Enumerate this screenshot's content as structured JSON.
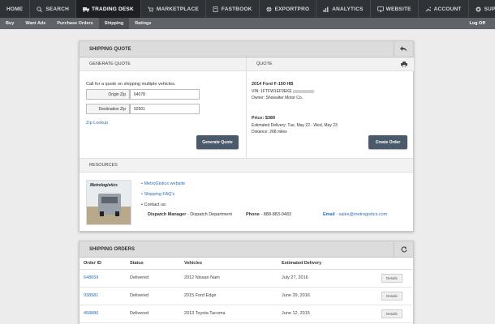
{
  "topnav": [
    {
      "label": "HOME",
      "icon": "none",
      "active": false
    },
    {
      "label": "SEARCH",
      "icon": "search-icon",
      "active": false
    },
    {
      "label": "TRADING DESK",
      "icon": "truck-icon",
      "active": true
    },
    {
      "label": "MARKETPLACE",
      "icon": "cart-icon",
      "active": false
    },
    {
      "label": "FASTBOOK",
      "icon": "book-icon",
      "active": false
    },
    {
      "label": "EXPORTPRO",
      "icon": "globe-icon",
      "active": false
    },
    {
      "label": "ANALYTICS",
      "icon": "chart-icon",
      "active": false
    },
    {
      "label": "WEBSITE",
      "icon": "monitor-icon",
      "active": false
    },
    {
      "label": "ACCOUNT",
      "icon": "wrench-icon",
      "active": false
    },
    {
      "label": "SUPPORT",
      "icon": "lifebuoy-icon",
      "active": false
    }
  ],
  "subnav": [
    {
      "label": "Buy",
      "active": false
    },
    {
      "label": "Want Ads",
      "active": false
    },
    {
      "label": "Purchase Orders",
      "active": false
    },
    {
      "label": "Shipping",
      "active": true
    },
    {
      "label": "Ratings",
      "active": false
    }
  ],
  "logoff": "Log Off",
  "shipping_quote": {
    "title": "SHIPPING QUOTE",
    "generate": {
      "title": "GENERATE QUOTE",
      "intro": "Call for a quote on shipping multiple vehicles.",
      "origin_label": "Origin Zip",
      "origin_value": "64078",
      "dest_label": "Destination Zip",
      "dest_value": "92901",
      "zip_lookup": "Zip Lookup",
      "button": "Generate Quote"
    },
    "quote": {
      "title": "QUOTE",
      "vehicle": "2014 Ford F-150 HB",
      "vin_label": "VIN:",
      "vin_value": "1FTFW1EF9EKE",
      "owner": "Owner: Showalter Motor Co.",
      "price": "Price: $389",
      "delivery": "Estimated Delivery: Tue, May 22 - Wed, May 23",
      "distance": "Distance: 268 miles",
      "button": "Create Order"
    },
    "resources": {
      "title": "RESOURCES",
      "logo_text": "Metrologistics",
      "links": [
        "MetroGistics website",
        "Shipping FAQ's"
      ],
      "contact_label": "Contact us:",
      "dispatch_label": "Dispatch Manager",
      "dispatch_value": " - Dispatch Department",
      "phone_label": "Phone",
      "phone_value": " - 888-883-0483",
      "email_label": "Email",
      "email_value": "sales@metrogistics.com"
    }
  },
  "orders": {
    "title": "SHIPPING ORDERS",
    "columns": [
      "Order ID",
      "Status",
      "Vehicles",
      "Estimated Delivery",
      ""
    ],
    "rows": [
      {
        "id": "648659",
        "status": "Delivered",
        "vehicle": "2012 Nissan Nam",
        "delivery": "July 27, 2016",
        "action": "Details"
      },
      {
        "id": "938981",
        "status": "Delivered",
        "vehicle": "2015 Ford Edge",
        "delivery": "June 29, 2016",
        "action": "Details"
      },
      {
        "id": "458880",
        "status": "Delivered",
        "vehicle": "2013 Toyota Tacoma",
        "delivery": "June 12, 2015",
        "action": "Details"
      }
    ]
  },
  "colors": {
    "nav": "#2f3236",
    "subnav": "#5f6368",
    "button": "#4b5a6a",
    "link": "#2a6fb5"
  }
}
